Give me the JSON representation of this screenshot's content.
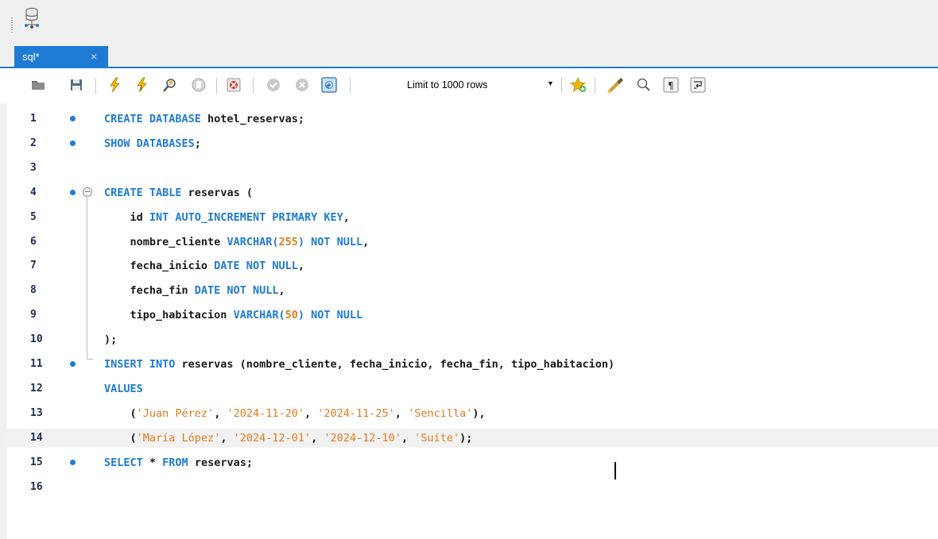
{
  "tab": {
    "label": "sql*",
    "close": "×"
  },
  "toolbar": {
    "limit_label": "Limit to 1000 rows",
    "dropdown_caret": "▼",
    "icons": [
      "open-folder-icon",
      "save-icon",
      "execute-icon",
      "execute-current-icon",
      "explain-icon",
      "stop-icon",
      "toggle-continue-icon",
      "commit-icon",
      "rollback-icon",
      "autocommit-icon",
      "add-snippet-icon",
      "beautify-icon",
      "find-icon",
      "invisible-chars-icon",
      "wrap-lines-icon"
    ]
  },
  "colors": {
    "accent": "#1e7bd3",
    "keyword": "#1e7bd3",
    "literal": "#e27c1e"
  },
  "editor": {
    "lines": [
      {
        "number": "1",
        "dot": true,
        "fold": false,
        "tokens": [
          [
            "kw",
            "CREATE DATABASE"
          ],
          [
            "id",
            " hotel_reservas"
          ],
          [
            "punct",
            ";"
          ]
        ]
      },
      {
        "number": "2",
        "dot": true,
        "fold": false,
        "tokens": [
          [
            "kw",
            "SHOW DATABASES"
          ],
          [
            "punct",
            ";"
          ]
        ]
      },
      {
        "number": "3",
        "dot": false,
        "fold": false,
        "tokens": []
      },
      {
        "number": "4",
        "dot": true,
        "fold": true,
        "tokens": [
          [
            "kw",
            "CREATE TABLE"
          ],
          [
            "id",
            " reservas "
          ],
          [
            "punct",
            "("
          ]
        ]
      },
      {
        "number": "5",
        "dot": false,
        "fold": false,
        "tokens": [
          [
            "id",
            "    id "
          ],
          [
            "kw",
            "INT AUTO_INCREMENT PRIMARY KEY"
          ],
          [
            "punct",
            ","
          ]
        ]
      },
      {
        "number": "6",
        "dot": false,
        "fold": false,
        "tokens": [
          [
            "id",
            "    nombre_cliente "
          ],
          [
            "kw",
            "VARCHAR("
          ],
          [
            "num",
            "255"
          ],
          [
            "kw",
            ") NOT NULL"
          ],
          [
            "punct",
            ","
          ]
        ]
      },
      {
        "number": "7",
        "dot": false,
        "fold": false,
        "tokens": [
          [
            "id",
            "    fecha_inicio "
          ],
          [
            "kw",
            "DATE NOT NULL"
          ],
          [
            "punct",
            ","
          ]
        ]
      },
      {
        "number": "8",
        "dot": false,
        "fold": false,
        "tokens": [
          [
            "id",
            "    fecha_fin "
          ],
          [
            "kw",
            "DATE NOT NULL"
          ],
          [
            "punct",
            ","
          ]
        ]
      },
      {
        "number": "9",
        "dot": false,
        "fold": false,
        "tokens": [
          [
            "id",
            "    tipo_habitacion "
          ],
          [
            "kw",
            "VARCHAR("
          ],
          [
            "num",
            "50"
          ],
          [
            "kw",
            ") NOT NULL"
          ]
        ]
      },
      {
        "number": "10",
        "dot": false,
        "fold": false,
        "tokens": [
          [
            "punct",
            ");"
          ]
        ]
      },
      {
        "number": "11",
        "dot": true,
        "fold": false,
        "tokens": [
          [
            "kw",
            "INSERT INTO"
          ],
          [
            "id",
            " reservas (nombre_cliente, fecha_inicio, fecha_fin, tipo_habitacion)"
          ]
        ]
      },
      {
        "number": "12",
        "dot": false,
        "fold": false,
        "tokens": [
          [
            "kw",
            "VALUES"
          ]
        ]
      },
      {
        "number": "13",
        "dot": false,
        "fold": false,
        "tokens": [
          [
            "punct",
            "    ("
          ],
          [
            "str",
            "'Juan Pérez'"
          ],
          [
            "punct",
            ", "
          ],
          [
            "str",
            "'2024-11-20'"
          ],
          [
            "punct",
            ", "
          ],
          [
            "str",
            "'2024-11-25'"
          ],
          [
            "punct",
            ", "
          ],
          [
            "str",
            "'Sencilla'"
          ],
          [
            "punct",
            "),"
          ]
        ]
      },
      {
        "number": "14",
        "dot": false,
        "fold": false,
        "current": true,
        "tokens": [
          [
            "punct",
            "    ("
          ],
          [
            "str",
            "'María López'"
          ],
          [
            "punct",
            ", "
          ],
          [
            "str",
            "'2024-12-01'"
          ],
          [
            "punct",
            ", "
          ],
          [
            "str",
            "'2024-12-10'"
          ],
          [
            "punct",
            ", "
          ],
          [
            "str",
            "'Suite'"
          ],
          [
            "punct",
            ");"
          ]
        ]
      },
      {
        "number": "15",
        "dot": true,
        "fold": false,
        "tokens": [
          [
            "kw",
            "SELECT"
          ],
          [
            "id",
            " * "
          ],
          [
            "kw",
            "FROM"
          ],
          [
            "id",
            " reservas"
          ],
          [
            "punct",
            ";"
          ]
        ]
      },
      {
        "number": "16",
        "dot": false,
        "fold": false,
        "tokens": []
      }
    ]
  }
}
